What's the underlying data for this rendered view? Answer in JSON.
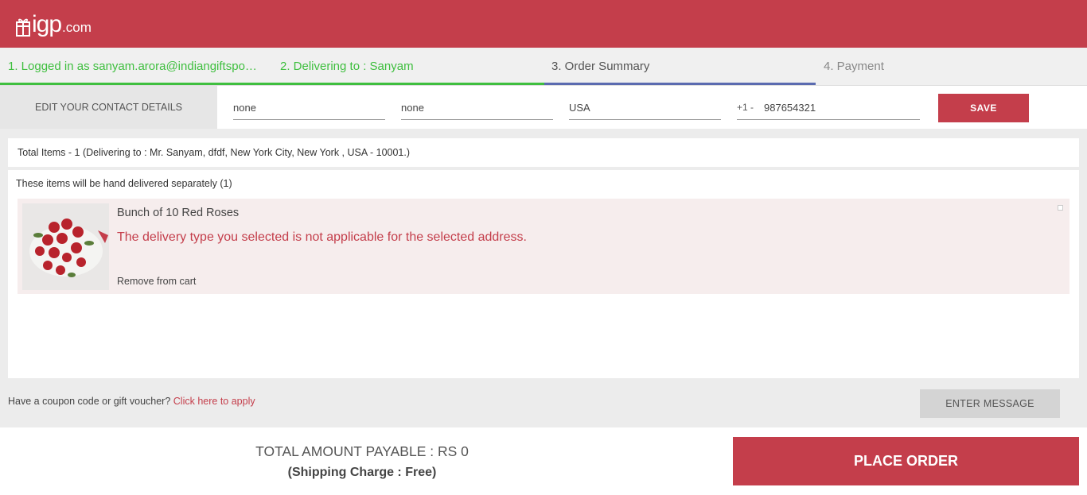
{
  "header": {
    "logo_main": "igp",
    "logo_suffix": ".com",
    "brand_color": "#c43e4b"
  },
  "steps": [
    {
      "label": "1. Logged in as sanyam.arora@indiangiftspo…",
      "state": "done"
    },
    {
      "label": "2. Delivering to : Sanyam",
      "state": "done"
    },
    {
      "label": "3. Order Summary",
      "state": "active"
    },
    {
      "label": "4. Payment",
      "state": "todo"
    }
  ],
  "contact": {
    "label": "EDIT YOUR CONTACT DETAILS",
    "field1": "none",
    "field2": "none",
    "country": "USA",
    "phone_prefix": "+1 -",
    "phone": "987654321",
    "save_label": "SAVE"
  },
  "summary": {
    "total_items": "Total Items - 1 (Delivering to : Mr. Sanyam, dfdf, New York City, New York , USA - 10001.)"
  },
  "items": {
    "heading": "These items will be hand delivered separately (1)",
    "product_name": "Bunch of 10 Red Roses",
    "error": "The delivery type you selected is not applicable for the selected address.",
    "remove_label": "Remove from cart"
  },
  "coupon": {
    "text": "Have a coupon code or gift voucher?",
    "link": "Click here to apply"
  },
  "message_button": "ENTER MESSAGE",
  "footer": {
    "total": "TOTAL AMOUNT PAYABLE : RS 0",
    "shipping": "(Shipping Charge : Free)",
    "place_order": "PLACE ORDER"
  }
}
